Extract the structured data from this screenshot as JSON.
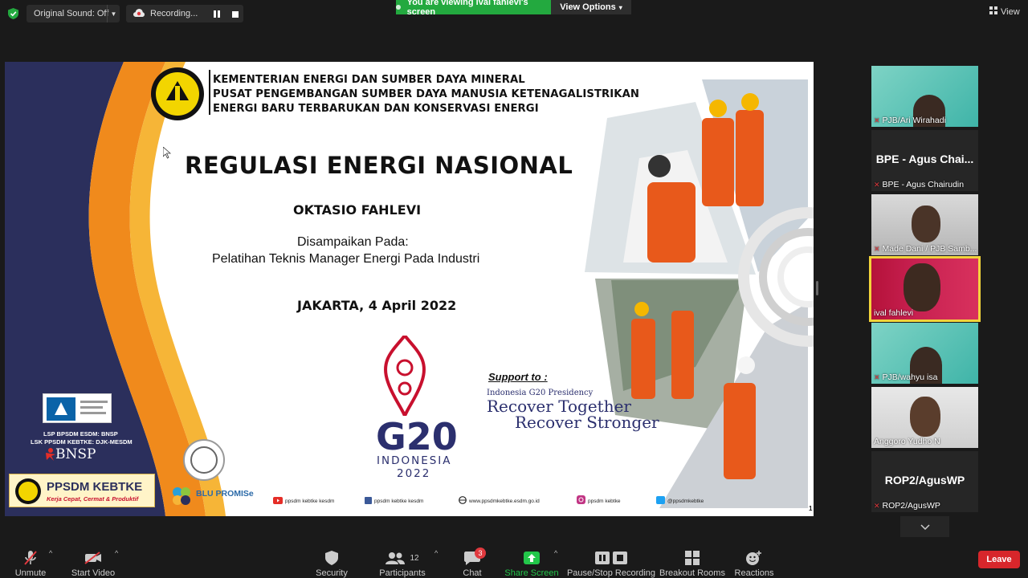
{
  "topbar": {
    "original_sound": "Original Sound: Off",
    "recording": "Recording...",
    "viewing_banner": "You are viewing ival fahlevi's screen",
    "view_options": "View Options",
    "view_button": "View"
  },
  "slide": {
    "ministry_lines": [
      "KEMENTERIAN ENERGI DAN SUMBER DAYA MINERAL",
      "PUSAT PENGEMBANGAN SUMBER DAYA MANUSIA KETENAGALISTRIKAN",
      "ENERGI BARU TERBARUKAN DAN KONSERVASI ENERGI"
    ],
    "title": "REGULASI ENERGI NASIONAL",
    "presenter": "OKTASIO FAHLEVI",
    "delivered_label": "Disampaikan Pada:",
    "event": "Pelatihan Teknis Manager Energi Pada Industri",
    "place_date": "JAKARTA, 4 April 2022",
    "g20_main": "G20",
    "g20_country": "INDONESIA",
    "g20_year": "2022",
    "support_to": "Support to :",
    "presidency": "Indonesia G20 Presidency",
    "recover1": "Recover Together",
    "recover2": "Recover Stronger",
    "lsp_line1": "LSP BPSDM ESDM: BNSP",
    "lsp_line2": "LSK PPSDM KEBTKE: DJK-MESDM",
    "bnsp": "BNSP",
    "ppsdm": "PPSDM KEBTKE",
    "ppsdm_tag": "Kerja Cepat, Cermat & Produktif",
    "blu": "BLU PROMISe",
    "socials": [
      {
        "icon": "youtube-icon",
        "label": "ppsdm kebtke kesdm",
        "color": "#e52d27"
      },
      {
        "icon": "facebook-icon",
        "label": "ppsdm kebtke kesdm",
        "color": "#3b5998"
      },
      {
        "icon": "globe-icon",
        "label": "www.ppsdmkebtke.esdm.go.id",
        "color": "#222222"
      },
      {
        "icon": "instagram-icon",
        "label": "ppsdm kebtke",
        "color": "#c13584"
      },
      {
        "icon": "twitter-icon",
        "label": "@ppsdmkebtke",
        "color": "#1da1f2"
      }
    ],
    "page_number": "1"
  },
  "participants": [
    {
      "name": "PJB/Ari Wirahadi",
      "type": "video"
    },
    {
      "name": "BPE - Agus Chairudin",
      "big": "BPE - Agus Chai...",
      "type": "name"
    },
    {
      "name": "Made Dani / PJB Samb...",
      "type": "video"
    },
    {
      "name": "ival fahlevi",
      "type": "video",
      "active": true
    },
    {
      "name": "PJB/wahyu isa",
      "type": "video"
    },
    {
      "name": "Anggoro Yudho N",
      "type": "video"
    },
    {
      "name": "ROP2/AgusWP",
      "big": "ROP2/AgusWP",
      "type": "name"
    }
  ],
  "toolbar": {
    "unmute": "Unmute",
    "start_video": "Start Video",
    "security": "Security",
    "participants": "Participants",
    "participants_count": "12",
    "chat": "Chat",
    "chat_badge": "3",
    "share_screen": "Share Screen",
    "pause_stop": "Pause/Stop Recording",
    "breakout": "Breakout Rooms",
    "reactions": "Reactions",
    "leave": "Leave"
  },
  "colors": {
    "accent_green": "#23a93f",
    "leave_red": "#d7262b",
    "active_border": "#f2d43b",
    "slide_navy": "#2b2f5c",
    "slide_orange": "#f08a1c"
  }
}
